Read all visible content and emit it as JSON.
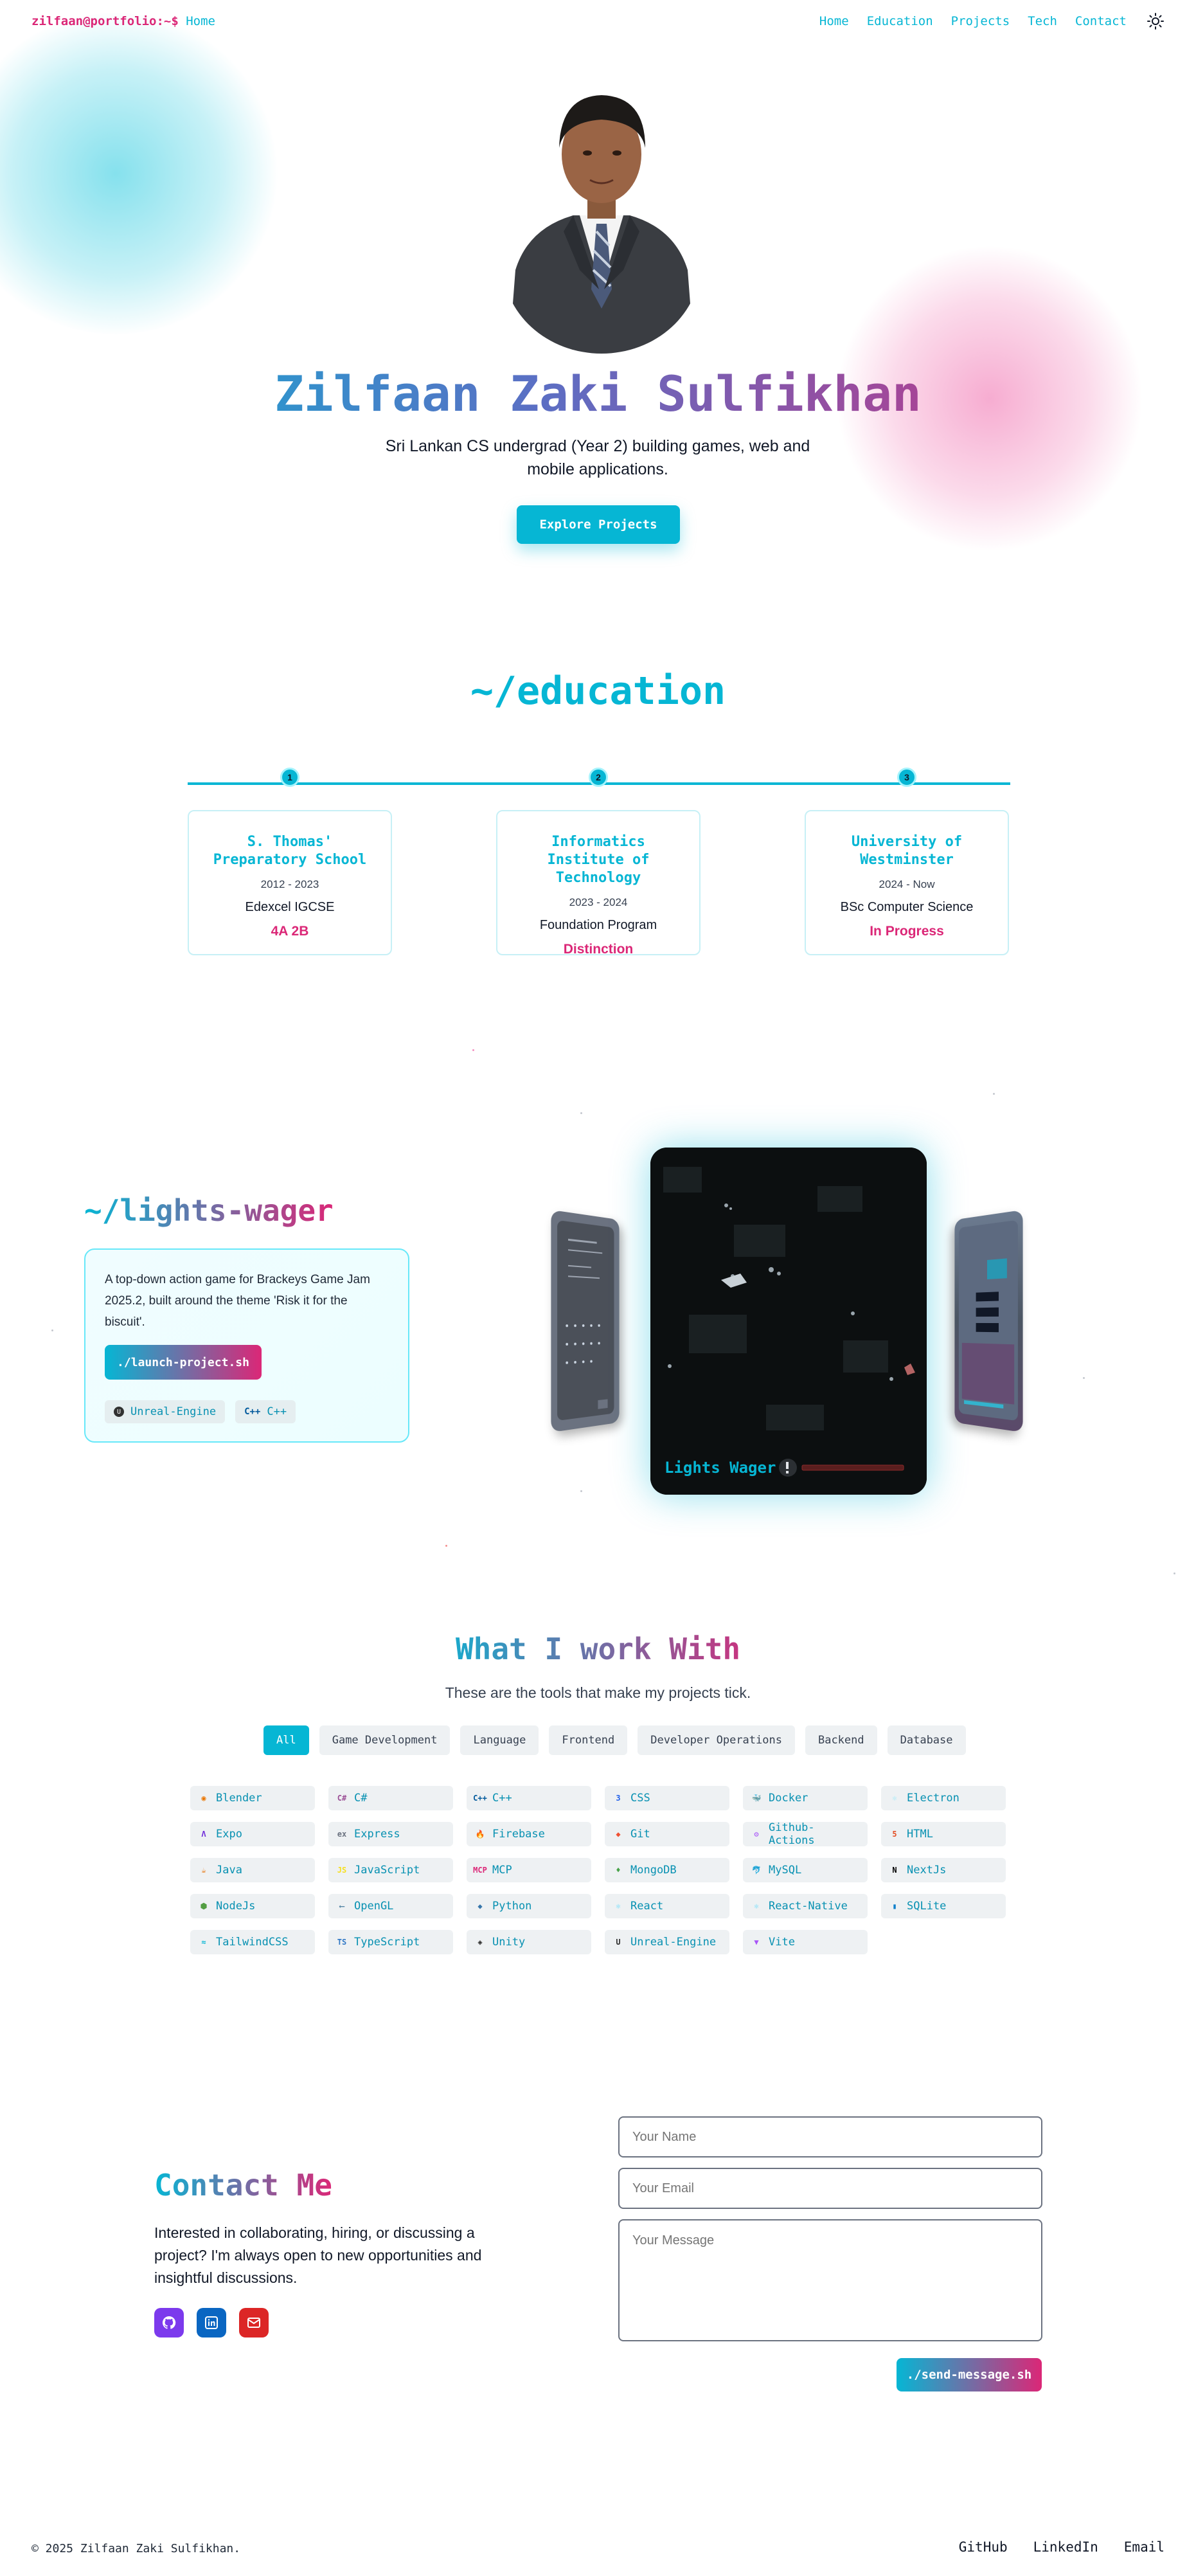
{
  "nav": {
    "brand_user": "zilfaan@portfolio:~$",
    "brand_page": "Home",
    "links": [
      "Home",
      "Education",
      "Projects",
      "Tech",
      "Contact"
    ]
  },
  "hero": {
    "name": "Zilfaan Zaki Sulfikhan",
    "subtitle": "Sri Lankan CS undergrad (Year 2) building games, web and mobile applications.",
    "cta": "Explore Projects"
  },
  "education": {
    "title": "~/education",
    "items": [
      {
        "step": "1",
        "school": "S. Thomas' Preparatory School",
        "years": "2012 - 2023",
        "program": "Edexcel IGCSE",
        "result": "4A 2B"
      },
      {
        "step": "2",
        "school": "Informatics Institute of Technology",
        "years": "2023 - 2024",
        "program": "Foundation Program",
        "result": "Distinction"
      },
      {
        "step": "3",
        "school": "University of Westminster",
        "years": "2024 - Now",
        "program": "BSc Computer Science",
        "result": "In Progress"
      }
    ]
  },
  "project": {
    "title": "~/lights-wager",
    "description": "A top-down action game for Brackeys Game Jam 2025.2, built around the theme 'Risk it for the biscuit'.",
    "launch": "./launch-project.sh",
    "tags": [
      {
        "label": "Unreal-Engine",
        "icon": "unreal-icon"
      },
      {
        "label": "C++",
        "icon": "cpp-icon"
      }
    ],
    "screenshot_caption": "Lights Wager"
  },
  "tools": {
    "title": "What I work With",
    "subtitle": "These are the tools that make my projects tick.",
    "filters": [
      "All",
      "Game Development",
      "Language",
      "Frontend",
      "Developer Operations",
      "Backend",
      "Database"
    ],
    "active_filter": "All",
    "items": [
      {
        "label": "Blender",
        "icon": "blender-icon",
        "glyph": "◉",
        "color": "#ea7600"
      },
      {
        "label": "C#",
        "icon": "csharp-icon",
        "glyph": "C#",
        "color": "#9b4f96"
      },
      {
        "label": "C++",
        "icon": "cpp-icon",
        "glyph": "C++",
        "color": "#00599c"
      },
      {
        "label": "CSS",
        "icon": "css-icon",
        "glyph": "3",
        "color": "#2563eb"
      },
      {
        "label": "Docker",
        "icon": "docker-icon",
        "glyph": "🐳",
        "color": "#2496ed"
      },
      {
        "label": "Electron",
        "icon": "electron-icon",
        "glyph": "⚛",
        "color": "#9feaf9"
      },
      {
        "label": "Expo",
        "icon": "expo-icon",
        "glyph": "Λ",
        "color": "#6d28d9"
      },
      {
        "label": "Express",
        "icon": "express-icon",
        "glyph": "ex",
        "color": "#6b7280"
      },
      {
        "label": "Firebase",
        "icon": "firebase-icon",
        "glyph": "🔥",
        "color": "#f59e0b"
      },
      {
        "label": "Git",
        "icon": "git-icon",
        "glyph": "◆",
        "color": "#f05032"
      },
      {
        "label": "Github-Actions",
        "icon": "github-actions-icon",
        "glyph": "⚙",
        "color": "#a855f7"
      },
      {
        "label": "HTML",
        "icon": "html-icon",
        "glyph": "5",
        "color": "#e34f26"
      },
      {
        "label": "Java",
        "icon": "java-icon",
        "glyph": "☕",
        "color": "#e76f00"
      },
      {
        "label": "JavaScript",
        "icon": "javascript-icon",
        "glyph": "JS",
        "color": "#f7df1e"
      },
      {
        "label": "MCP",
        "icon": "mcp-icon",
        "glyph": "MCP",
        "color": "#db2777"
      },
      {
        "label": "MongoDB",
        "icon": "mongodb-icon",
        "glyph": "♦",
        "color": "#47a248"
      },
      {
        "label": "MySQL",
        "icon": "mysql-icon",
        "glyph": "🐬",
        "color": "#f29111"
      },
      {
        "label": "NextJs",
        "icon": "nextjs-icon",
        "glyph": "N",
        "color": "#000000"
      },
      {
        "label": "NodeJs",
        "icon": "nodejs-icon",
        "glyph": "⬢",
        "color": "#539e43"
      },
      {
        "label": "OpenGL",
        "icon": "opengl-icon",
        "glyph": "⟵",
        "color": "#5586a4"
      },
      {
        "label": "Python",
        "icon": "python-icon",
        "glyph": "◆",
        "color": "#3776ab"
      },
      {
        "label": "React",
        "icon": "react-icon",
        "glyph": "⚛",
        "color": "#61dafb"
      },
      {
        "label": "React-Native",
        "icon": "react-native-icon",
        "glyph": "⚛",
        "color": "#61dafb"
      },
      {
        "label": "SQLite",
        "icon": "sqlite-icon",
        "glyph": "▮",
        "color": "#0f80cc"
      },
      {
        "label": "TailwindCSS",
        "icon": "tailwind-icon",
        "glyph": "≈",
        "color": "#06b6d4"
      },
      {
        "label": "TypeScript",
        "icon": "typescript-icon",
        "glyph": "TS",
        "color": "#3178c6"
      },
      {
        "label": "Unity",
        "icon": "unity-icon",
        "glyph": "◈",
        "color": "#222222"
      },
      {
        "label": "Unreal-Engine",
        "icon": "unreal-icon",
        "glyph": "U",
        "color": "#313131"
      },
      {
        "label": "Vite",
        "icon": "vite-icon",
        "glyph": "▼",
        "color": "#a855f7"
      }
    ]
  },
  "contact": {
    "title": "Contact Me",
    "text": "Interested in collaborating, hiring, or discussing a project? I'm always open to new opportunities and insightful discussions.",
    "name_placeholder": "Your Name",
    "email_placeholder": "Your Email",
    "message_placeholder": "Your Message",
    "send": "./send-message.sh",
    "socials": [
      {
        "icon": "github-icon",
        "color": "#7c3aed"
      },
      {
        "icon": "linkedin-icon",
        "color": "#0a66c2"
      },
      {
        "icon": "email-icon",
        "color": "#dc2626"
      }
    ]
  },
  "footer": {
    "copyright": "© 2025 Zilfaan Zaki Sulfikhan.",
    "links": [
      "GitHub",
      "LinkedIn",
      "Email"
    ]
  }
}
